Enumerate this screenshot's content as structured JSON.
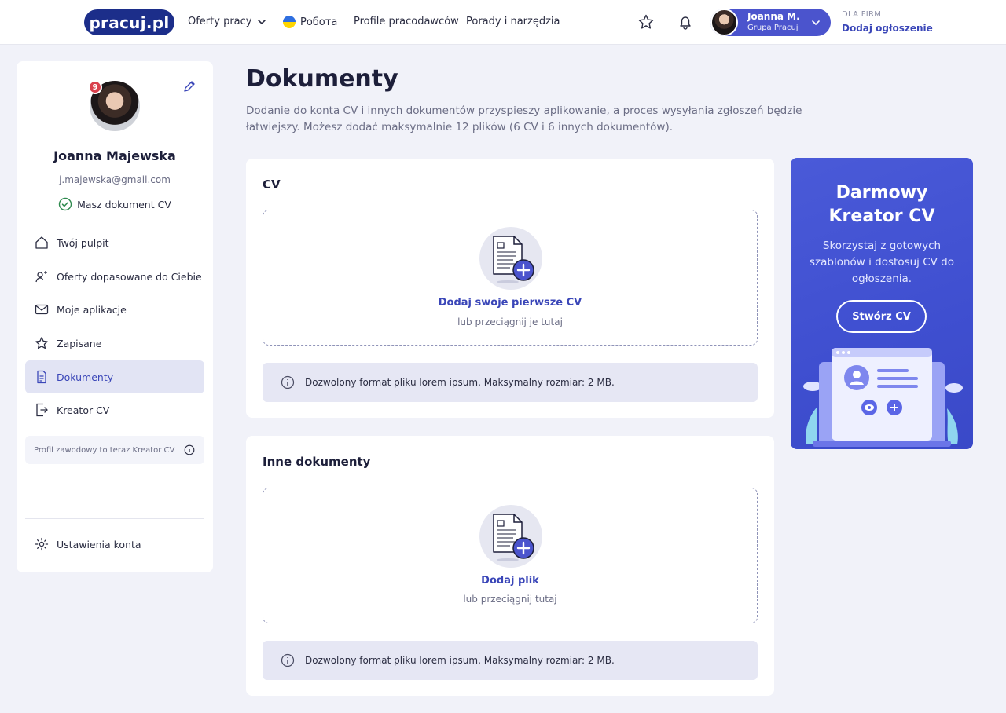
{
  "header": {
    "logo": "pracuj.pl",
    "nav": {
      "offers": "Oferty pracy",
      "robota": "Робота",
      "employers": "Profile pracodawców",
      "tips": "Porady i narzędzia"
    },
    "user": {
      "name": "Joanna M.",
      "company": "Grupa Pracuj"
    },
    "firms_small": "DLA FIRM",
    "firms_link": "Dodaj ogłoszenie"
  },
  "sidebar": {
    "badge_count": "9",
    "name": "Joanna Majewska",
    "email": "j.majewska@gmail.com",
    "cv_status": "Masz dokument CV",
    "items": [
      {
        "label": "Twój pulpit"
      },
      {
        "label": "Oferty dopasowane do Ciebie"
      },
      {
        "label": "Moje aplikacje"
      },
      {
        "label": "Zapisane"
      },
      {
        "label": "Dokumenty"
      },
      {
        "label": "Kreator CV"
      }
    ],
    "promo_note": "Profil zawodowy to teraz Kreator CV",
    "settings": "Ustawienia konta"
  },
  "main": {
    "title": "Dokumenty",
    "description": "Dodanie do konta CV i innych dokumentów przyspieszy aplikowanie, a proces wysyłania zgłoszeń będzie łatwiejszy. Możesz dodać maksymalnie 12 plików (6 CV i 6 innych dokumentów).",
    "cv_card": {
      "title": "CV",
      "action": "Dodaj swoje pierwsze CV",
      "sub": "lub przeciągnij je tutaj",
      "info": "Dozwolony format pliku lorem ipsum. Maksymalny rozmiar: 2 MB."
    },
    "other_card": {
      "title": "Inne dokumenty",
      "action": "Dodaj plik",
      "sub": "lub przeciągnij tutaj",
      "info": "Dozwolony format pliku lorem ipsum. Maksymalny rozmiar: 2 MB."
    }
  },
  "banner": {
    "title_line1": "Darmowy",
    "title_line2": "Kreator CV",
    "text": "Skorzystaj z gotowych szablonów i dostosuj CV do ogłoszenia.",
    "button": "Stwórz CV"
  },
  "colors": {
    "brand": "#1c2e8a",
    "accent": "#4b54cd",
    "link": "#3a46b8",
    "badge": "#d9404c"
  }
}
